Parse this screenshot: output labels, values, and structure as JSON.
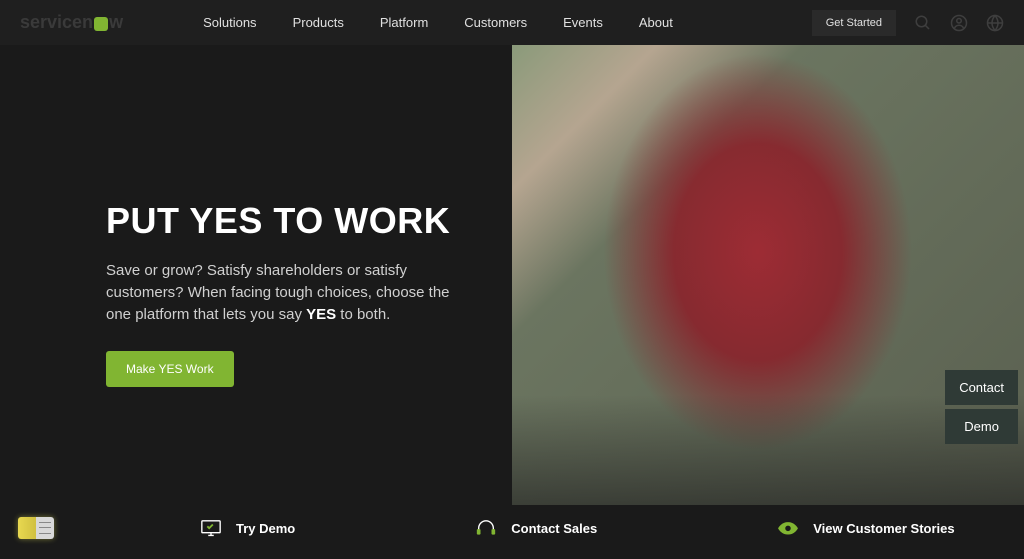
{
  "logo": {
    "text1": "servicen",
    "text2": "w"
  },
  "nav": {
    "items": [
      {
        "label": "Solutions"
      },
      {
        "label": "Products"
      },
      {
        "label": "Platform"
      },
      {
        "label": "Customers"
      },
      {
        "label": "Events"
      },
      {
        "label": "About"
      }
    ]
  },
  "header": {
    "get_started": "Get Started"
  },
  "hero": {
    "title": "PUT YES TO WORK",
    "desc_part1": "Save or grow? Satisfy shareholders or satisfy customers? When facing tough choices, choose the one platform that lets you say ",
    "desc_bold": "YES",
    "desc_part2": " to both.",
    "cta": "Make YES Work"
  },
  "side": {
    "contact": "Contact",
    "demo": "Demo"
  },
  "bottom": {
    "items": [
      {
        "label": "Try Demo"
      },
      {
        "label": "Contact Sales"
      },
      {
        "label": "View Customer Stories"
      }
    ]
  },
  "colors": {
    "accent_green": "#81b532",
    "dark_bg": "#1a1a1a"
  }
}
